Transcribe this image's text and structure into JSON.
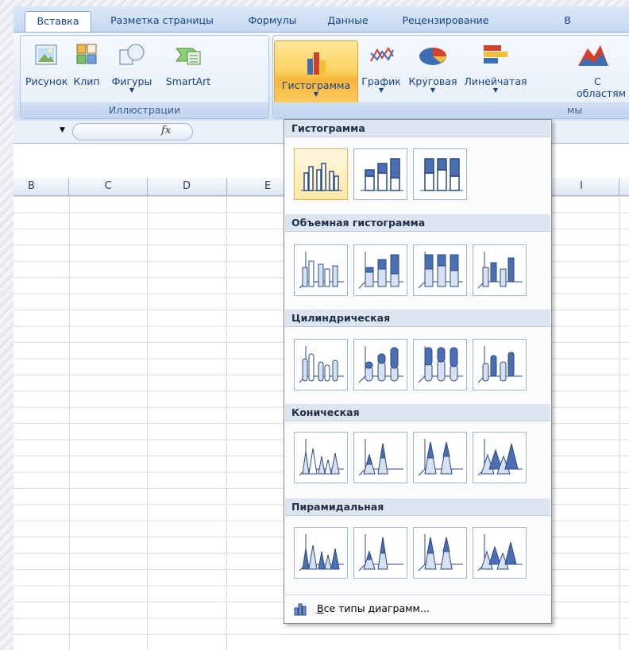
{
  "ribbon_tabs": [
    "Вставка",
    "Разметка страницы",
    "Формулы",
    "Данные",
    "Рецензирование",
    "В"
  ],
  "ribbon": {
    "illustrations": {
      "buttons": [
        "Рисунок",
        "Клип",
        "Фигуры",
        "SmartArt"
      ],
      "group_label": "Иллюстрации"
    },
    "charts": {
      "buttons": [
        "Гистограмма",
        "График",
        "Круговая",
        "Линейчатая"
      ],
      "area_button": [
        "С",
        "областям"
      ],
      "group_label_fragment": "мы"
    }
  },
  "formula_bar": {
    "fx_label": "fx"
  },
  "columns": [
    "B",
    "C",
    "D",
    "E",
    "I"
  ],
  "gallery": {
    "sections": [
      {
        "title": "Гистограмма",
        "items": [
          "clustered-column",
          "stacked-column",
          "100-stacked-column"
        ]
      },
      {
        "title": "Объемная гистограмма",
        "items": [
          "3d-clustered-column",
          "3d-stacked-column",
          "3d-100-stacked-column",
          "3d-column"
        ]
      },
      {
        "title": "Цилиндрическая",
        "items": [
          "clustered-cylinder",
          "stacked-cylinder",
          "100-stacked-cylinder",
          "3d-cylinder"
        ]
      },
      {
        "title": "Коническая",
        "items": [
          "clustered-cone",
          "stacked-cone",
          "100-stacked-cone",
          "3d-cone"
        ]
      },
      {
        "title": "Пирамидальная",
        "items": [
          "clustered-pyramid",
          "stacked-pyramid",
          "100-stacked-pyramid",
          "3d-pyramid"
        ]
      }
    ],
    "footer_label": "Все типы диаграмм..."
  },
  "colors": {
    "accent": "#15428b",
    "selected": "#fbd25d",
    "chart_blue": "#4a6fb3"
  }
}
